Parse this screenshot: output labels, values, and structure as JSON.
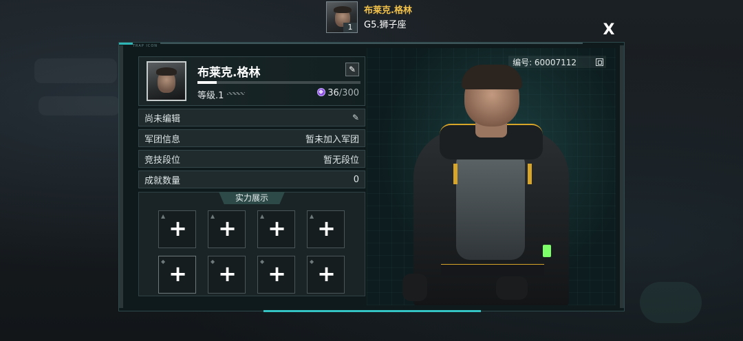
{
  "header": {
    "player_name": "布莱克.格林",
    "player_level": "1",
    "player_subtitle": "G5.狮子座"
  },
  "close_label": "X",
  "panel": {
    "tag": "TRAP ICON",
    "profile": {
      "name": "布莱克.格林",
      "edit_icon": "✎",
      "level_label": "等级.1",
      "xp_current": "36",
      "xp_max": "/300",
      "xp_fraction": 0.12
    },
    "rows": [
      {
        "label": "尚未编辑",
        "value": "",
        "icon": "pencil-icon"
      },
      {
        "label": "军团信息",
        "value": "暂未加入军团"
      },
      {
        "label": "竞技段位",
        "value": "暂无段位"
      },
      {
        "label": "成就数量",
        "value": "0"
      }
    ],
    "showcase": {
      "title": "实力展示",
      "slot_icon": "+",
      "slot_count": 8
    },
    "id_label": "编号: 60007112"
  },
  "colors": {
    "accent_gold": "#f2c14a",
    "accent_teal": "#35c4c4",
    "panel_bg": "#0e1a1c"
  }
}
